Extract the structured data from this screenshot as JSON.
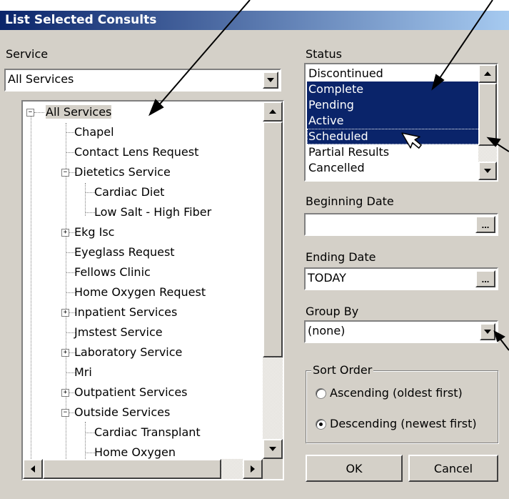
{
  "window": {
    "title": "List Selected Consults"
  },
  "service": {
    "label": "Service",
    "combo_value": "All Services",
    "tree": [
      "All Services",
      "Chapel",
      "Contact Lens Request",
      "Dietetics Service",
      "Cardiac Diet",
      "Low Salt - High Fiber",
      "Ekg Isc",
      "Eyeglass Request",
      "Fellows Clinic",
      "Home Oxygen Request",
      "Inpatient Services",
      "Jmstest Service",
      "Laboratory Service",
      "Mri",
      "Outpatient Services",
      "Outside Services",
      "Cardiac Transplant",
      "Home Oxygen"
    ]
  },
  "status": {
    "label": "Status",
    "items": [
      "Discontinued",
      "Complete",
      "Pending",
      "Active",
      "Scheduled",
      "Partial Results",
      "Cancelled"
    ],
    "selected": [
      "Complete",
      "Pending",
      "Active",
      "Scheduled"
    ]
  },
  "beginning_date": {
    "label": "Beginning Date",
    "value": "",
    "button": "..."
  },
  "ending_date": {
    "label": "Ending Date",
    "value": "TODAY",
    "button": "..."
  },
  "group_by": {
    "label": "Group By",
    "value": "(none)"
  },
  "sort_order": {
    "label": "Sort Order",
    "ascending": "Ascending (oldest first)",
    "descending": "Descending (newest first)",
    "selected": "descending"
  },
  "buttons": {
    "ok": "OK",
    "cancel": "Cancel"
  },
  "colors": {
    "selection": "#0a246a",
    "dialog": "#d4d0c8",
    "title_start": "#0a246a",
    "title_end": "#a6caf0"
  }
}
